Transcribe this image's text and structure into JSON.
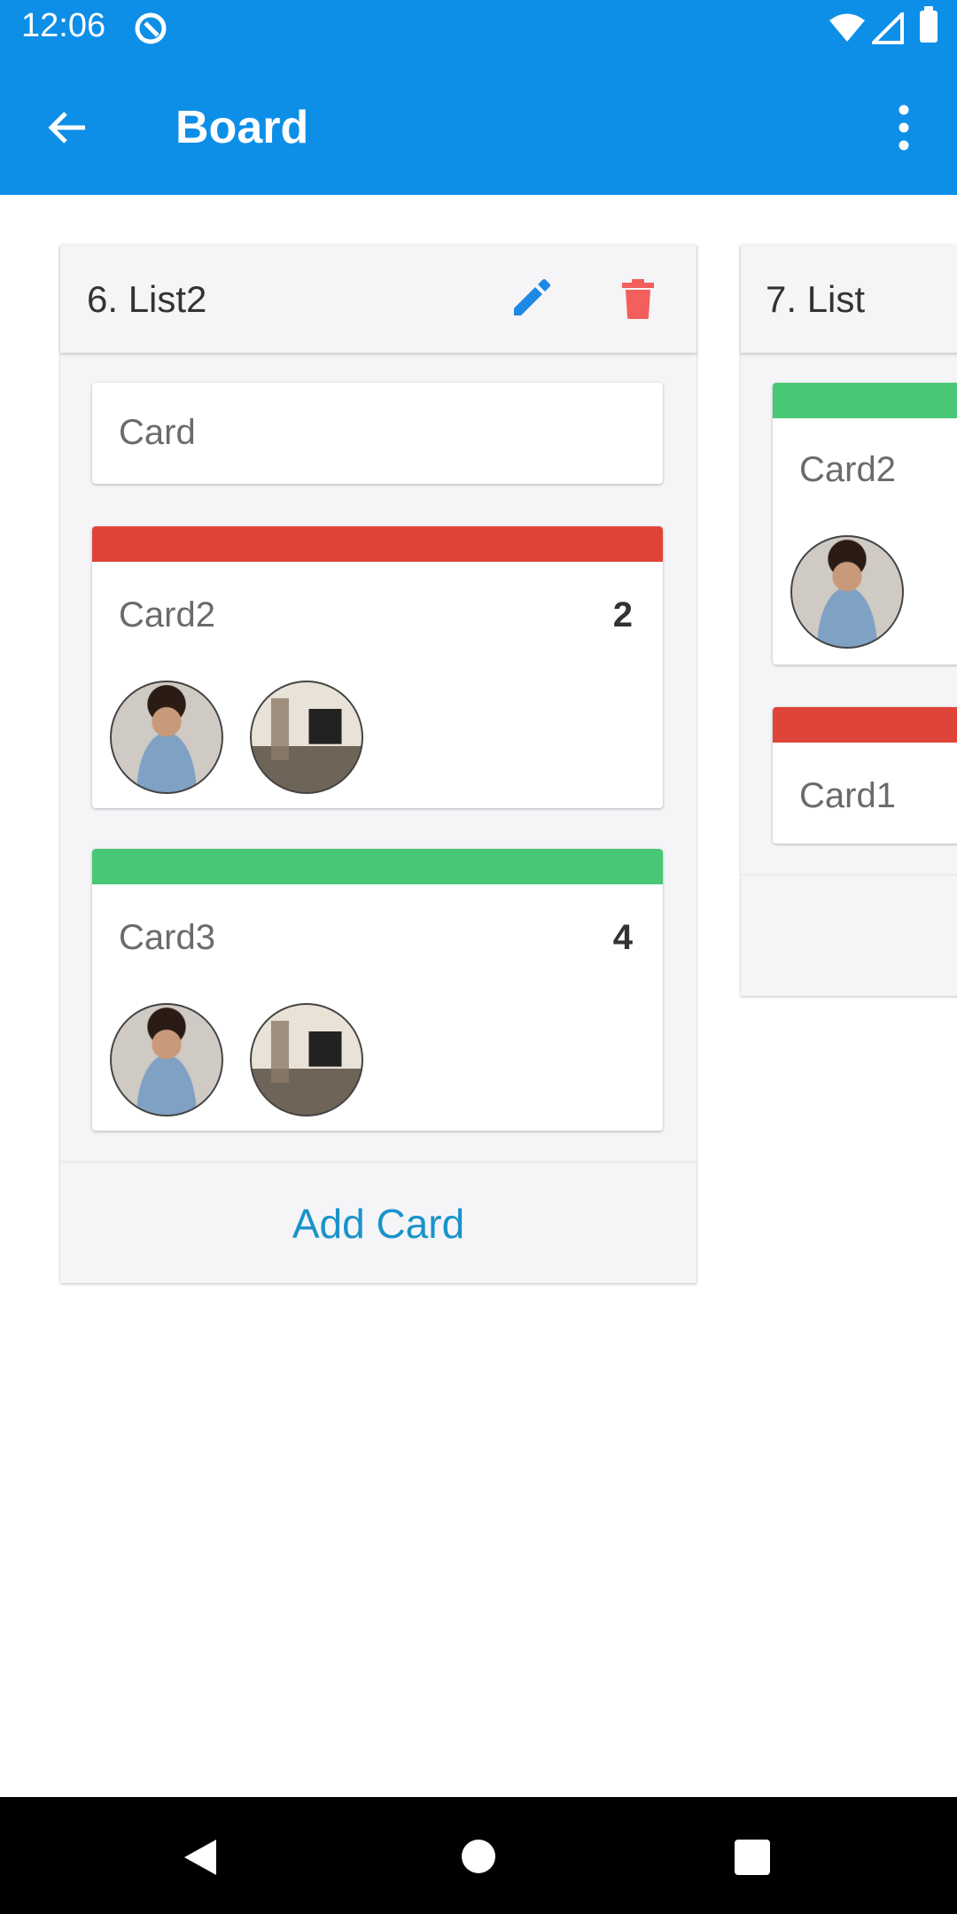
{
  "status_bar": {
    "time": "12:06"
  },
  "app_bar": {
    "title": "Board"
  },
  "lists": [
    {
      "title": "6. List2",
      "new_card_placeholder": "Card",
      "cards": [
        {
          "name": "Card2",
          "count": "2",
          "label_color": "#de4437"
        },
        {
          "name": "Card3",
          "count": "4",
          "label_color": "#48c774"
        }
      ],
      "add_card_label": "Add Card"
    },
    {
      "title": "7. List",
      "cards": [
        {
          "name": "Card2",
          "label_color": "#48c774"
        },
        {
          "name": "Card1",
          "label_color": "#de4437"
        }
      ]
    }
  ],
  "colors": {
    "app_bar": "#0d8fe8",
    "edit_icon": "#1e88e5",
    "delete_icon": "#f25f5c",
    "add_card_text": "#1a93c9"
  },
  "icons": [
    "back-arrow-icon",
    "more-vert-icon",
    "edit-pencil-icon",
    "trash-icon",
    "wifi-icon",
    "cellular-icon",
    "battery-icon",
    "at-sign-icon"
  ]
}
